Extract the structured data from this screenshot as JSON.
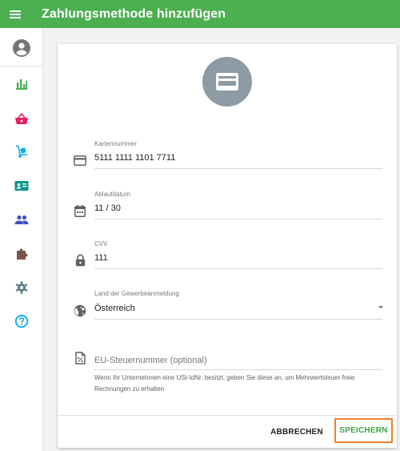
{
  "app": {
    "title": "Zahlungsmethode hinzufügen",
    "accent_color": "#4caf50",
    "menu_icon": "menu-icon"
  },
  "sidebar": {
    "avatar_icon": "account-circle-icon",
    "items": [
      {
        "icon": "bar-chart-icon",
        "color": "#4caf50"
      },
      {
        "icon": "shopping-basket-icon",
        "color": "#e91e63"
      },
      {
        "icon": "hand-truck-icon",
        "color": "#03a9f4"
      },
      {
        "icon": "contact-card-icon",
        "color": "#009688"
      },
      {
        "icon": "people-icon",
        "color": "#3f51b5"
      },
      {
        "icon": "puzzle-extension-icon",
        "color": "#795548"
      },
      {
        "icon": "gear-icon",
        "color": "#607d8b"
      },
      {
        "icon": "help-circle-icon",
        "color": "#03a9f4"
      }
    ]
  },
  "form": {
    "header_icon": "credit-card-icon",
    "card_number": {
      "label": "Kartennummer",
      "value": "5111 1111 1101 7711",
      "icon": "credit-card-icon"
    },
    "expiry": {
      "label": "Ablaufdatum",
      "value": "11 / 30",
      "icon": "calendar-icon"
    },
    "cvv": {
      "label": "CVV",
      "value": "111",
      "icon": "lock-icon"
    },
    "country": {
      "label": "Land der Gewerbeanmeldung",
      "value": "Österreich",
      "icon": "globe-icon"
    },
    "vat": {
      "placeholder": "EU-Steuernummer (optional)",
      "icon": "percent-document-icon",
      "hint": "Wenn Ihr Unternehmen eine USt-IdNr. besitzt, geben Sie diese an, um Mehrwertsteuer-freie Rechnungen zu erhalten"
    }
  },
  "actions": {
    "cancel": "ABBRECHEN",
    "save": "SPEICHERN",
    "save_color": "#43a047",
    "focus_outline_color": "#f07f2d"
  }
}
